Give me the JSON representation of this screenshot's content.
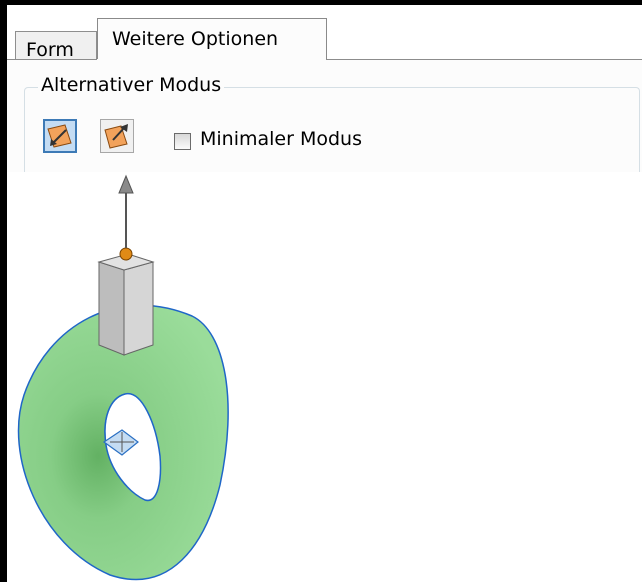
{
  "tabs": [
    {
      "label": "Form",
      "active": false
    },
    {
      "label": "Weitere Optionen",
      "active": true
    }
  ],
  "group": {
    "label": "Alternativer Modus"
  },
  "mode_buttons": [
    {
      "icon": "move-along-normal-icon",
      "pressed": true
    },
    {
      "icon": "move-opposite-normal-icon",
      "pressed": false
    }
  ],
  "minimal_mode": {
    "label": "Minimaler Modus",
    "checked": false
  },
  "colors": {
    "torus_fill": "#8ed38e",
    "torus_edge": "#1f66c8",
    "pillar": "#c9c9c9",
    "handle_ball": "#e08a16",
    "pressed_button": "#c4dcf3"
  }
}
